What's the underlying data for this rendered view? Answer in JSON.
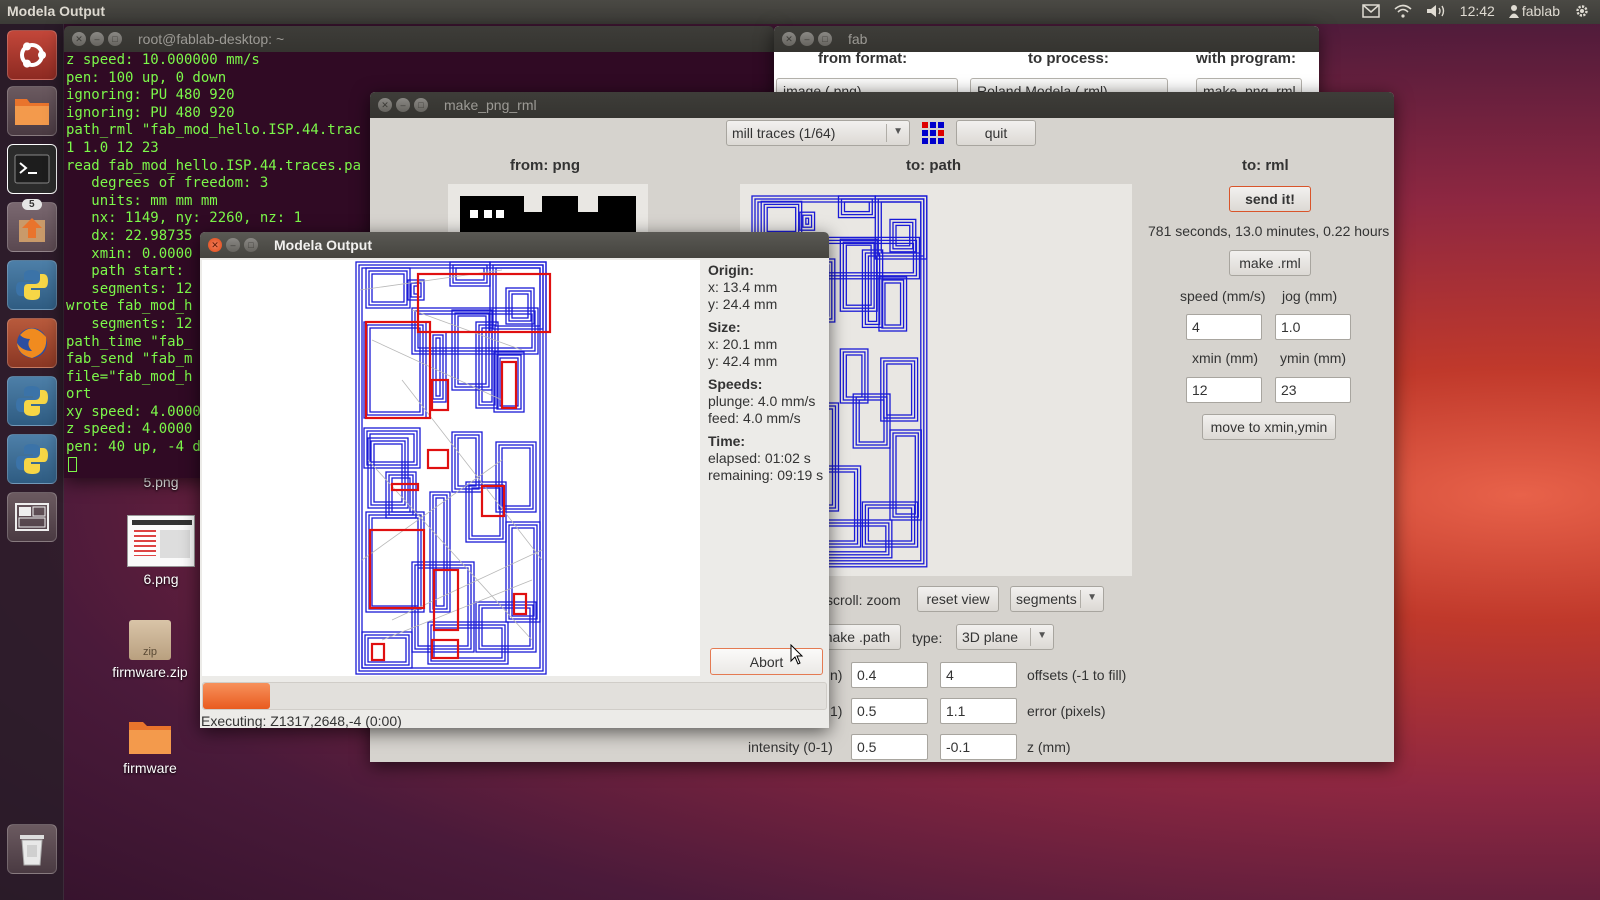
{
  "top_panel": {
    "app_title": "Modela Output",
    "time": "12:42",
    "user": "fablab",
    "icons": [
      "mail-icon",
      "wifi-icon",
      "volume-icon",
      "user-icon",
      "gear-icon"
    ]
  },
  "launcher": {
    "items": [
      {
        "name": "dash-home",
        "icon": "ubuntu-logo-icon"
      },
      {
        "name": "files",
        "icon": "folder-icon"
      },
      {
        "name": "terminal",
        "icon": "terminal-icon"
      },
      {
        "name": "software-updater",
        "icon": "update-icon",
        "badge": "5"
      },
      {
        "name": "python-1",
        "icon": "python-icon"
      },
      {
        "name": "firefox",
        "icon": "firefox-icon"
      },
      {
        "name": "python-2",
        "icon": "python-icon"
      },
      {
        "name": "python-3",
        "icon": "python-icon"
      },
      {
        "name": "workspace-switcher",
        "icon": "workspace-icon"
      },
      {
        "name": "trash",
        "icon": "trash-icon"
      }
    ]
  },
  "desktop": {
    "icons": [
      {
        "label": "5.png"
      },
      {
        "label": "6.png"
      },
      {
        "label": "firmware.zip",
        "badge": "zip"
      },
      {
        "label": "firmware"
      }
    ]
  },
  "terminal": {
    "title": "root@fablab-desktop: ~",
    "lines": [
      "z speed: 10.000000 mm/s",
      "pen: 100 up, 0 down",
      "ignoring: PU 480 920",
      "ignoring: PU 480 920",
      "path_rml \"fab_mod_hello.ISP.44.trac",
      "1 1.0 12 23",
      "read fab_mod_hello.ISP.44.traces.pa",
      "   degrees of freedom: 3",
      "   units: mm mm mm",
      "   nx: 1149, ny: 2260, nz: 1",
      "   dx: 22.98735",
      "   xmin: 0.0000",
      "   path start:",
      "   segments: 12",
      "wrote fab_mod_h",
      "   segments: 12",
      "path_time \"fab_",
      "fab_send \"fab_m",
      "file=\"fab_mod_h",
      "ort",
      "xy speed: 4.0000",
      "z speed: 4.0000",
      "pen: 40 up, -4 d"
    ]
  },
  "fab": {
    "title": "fab",
    "from_format_label": "from format:",
    "to_process_label": "to process:",
    "with_program_label": "with program:",
    "from_format_value": "image (.png)",
    "to_process_value": "Roland Modela (.rml)",
    "with_program_value": "make_png_rml"
  },
  "make_png_rml": {
    "title": "make_png_rml",
    "mode_select": "mill traces (1/64)",
    "quit_label": "quit",
    "from_header": "from: png",
    "to_path_header": "to: path",
    "to_rml_header": "to: rml",
    "send_label": "send it!",
    "time_estimate": "781 seconds, 13.0 minutes, 0.22 hours",
    "make_rml_label": "make .rml",
    "speed_label": "speed (mm/s)",
    "jog_label": "jog (mm)",
    "speed_value": "4",
    "jog_value": "1.0",
    "xmin_label": "xmin (mm)",
    "ymin_label": "ymin (mm)",
    "xmin_value": "12",
    "ymin_value": "23",
    "move_label": "move to xmin,ymin",
    "scroll_zoom_label": "scroll: zoom",
    "reset_view_label": "reset view",
    "view_select": "segments",
    "make_path_label": "make .path",
    "type_label": "type:",
    "type_select": "3D plane",
    "row1_left_label": "n)",
    "row1_a": "0.4",
    "row1_b": "4",
    "offsets_label": "offsets (-1 to fill)",
    "row2_left_label": "1)",
    "row2_a": "0.5",
    "row2_b": "1.1",
    "error_label": "error (pixels)",
    "intensity_label": "intensity (0-1)",
    "row3_a": "0.5",
    "row3_b": "-0.1",
    "z_label": "z (mm)"
  },
  "modela_output": {
    "title": "Modela Output",
    "origin_header": "Origin:",
    "origin_x": "x: 13.4 mm",
    "origin_y": "y: 24.4 mm",
    "size_header": "Size:",
    "size_x": "x: 20.1 mm",
    "size_y": "y: 42.4 mm",
    "speeds_header": "Speeds:",
    "plunge": "plunge: 4.0 mm/s",
    "feed": "feed: 4.0 mm/s",
    "time_header": "Time:",
    "elapsed": "elapsed: 01:02 s",
    "remaining": "remaining: 09:19 s",
    "abort_label": "Abort",
    "progress": 0.108,
    "status": "Executing: Z1317,2648,-4 (0:00)"
  },
  "colors": {
    "toolpath": "#1a1ad6",
    "cut_highlight": "#e01010",
    "progress": "#e95b1f",
    "terminal_text": "#7cf84a",
    "terminal_bg": "#300a24"
  }
}
